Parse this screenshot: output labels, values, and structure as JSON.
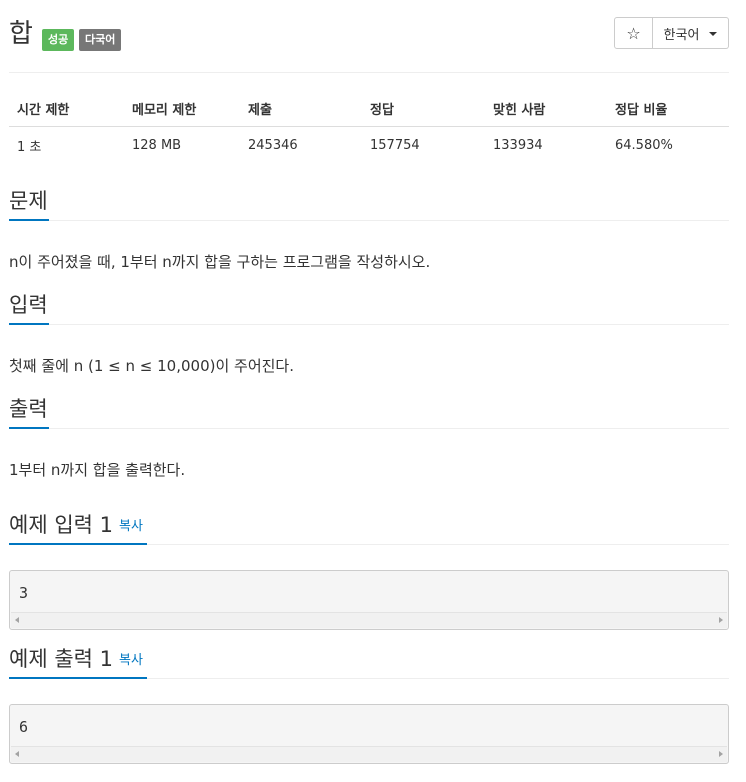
{
  "header": {
    "title": "합",
    "badge_success": "성공",
    "badge_multilang": "다국어",
    "star_icon": "☆",
    "language": "한국어"
  },
  "stats": {
    "headers": [
      "시간 제한",
      "메모리 제한",
      "제출",
      "정답",
      "맞힌 사람",
      "정답 비율"
    ],
    "values": [
      "1 초",
      "128 MB",
      "245346",
      "157754",
      "133934",
      "64.580%"
    ]
  },
  "problem": {
    "title": "문제",
    "text": "n이 주어졌을 때, 1부터 n까지 합을 구하는 프로그램을 작성하시오."
  },
  "input": {
    "title": "입력",
    "text": "첫째 줄에 n (1 ≤ n ≤ 10,000)이 주어진다."
  },
  "output": {
    "title": "출력",
    "text": "1부터 n까지 합을 출력한다."
  },
  "sample_input": {
    "title": "예제 입력 1",
    "copy_label": "복사",
    "value": "3"
  },
  "sample_output": {
    "title": "예제 출력 1",
    "copy_label": "복사",
    "value": "6"
  },
  "colors": {
    "accent": "#0076c0",
    "success": "#5cb85c",
    "neutral_badge": "#777777"
  }
}
